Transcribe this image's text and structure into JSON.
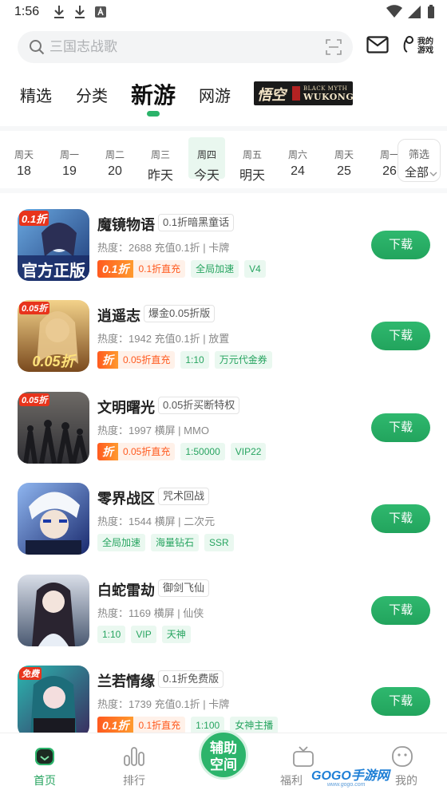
{
  "status_bar": {
    "time": "1:56"
  },
  "search": {
    "placeholder": "三国志战歌"
  },
  "header": {
    "my_games_line1": "我的",
    "my_games_line2": "游戏"
  },
  "tabs": [
    {
      "label": "精选"
    },
    {
      "label": "分类"
    },
    {
      "label": "新游",
      "active": true
    },
    {
      "label": "网游"
    }
  ],
  "banner": {
    "cn": "悟空",
    "en_line1": "BLACK MYTH",
    "en_line2": "WUKONG"
  },
  "days": [
    {
      "weekday": "周天",
      "date": "18"
    },
    {
      "weekday": "周一",
      "date": "19"
    },
    {
      "weekday": "周二",
      "date": "20"
    },
    {
      "weekday": "周三",
      "date": "昨天"
    },
    {
      "weekday": "周四",
      "date": "今天",
      "selected": true
    },
    {
      "weekday": "周五",
      "date": "明天"
    },
    {
      "weekday": "周六",
      "date": "24"
    },
    {
      "weekday": "周天",
      "date": "25"
    },
    {
      "weekday": "周一",
      "date": "26"
    }
  ],
  "filter": {
    "title": "筛选",
    "value": "全部"
  },
  "games": [
    {
      "name": "魔镜物语",
      "tagline": "0.1折暗黑童话",
      "heat_label": "热度：",
      "heat": "2688",
      "meta": "充值0.1折 | 卡牌",
      "discount_badge": "0.1折",
      "discount_text": "0.1折直充",
      "tags": [
        "全局加速",
        "V4"
      ],
      "thumb_text": "官方正版",
      "thumb_badge": "0.1折",
      "thumb_colors": [
        "#1e3b78",
        "#6aa8e0"
      ],
      "download": "下载"
    },
    {
      "name": "逍遥志",
      "tagline": "爆金0.05折版",
      "heat_label": "热度：",
      "heat": "1942",
      "meta": "充值0.1折 | 放置",
      "discount_badge": "折",
      "discount_text": "0.05折直充",
      "tags": [
        "1:10",
        "万元代金券"
      ],
      "thumb_text": "0.05折",
      "thumb_badge": "0.05折",
      "thumb_colors": [
        "#7a4a1e",
        "#f3d28a"
      ],
      "download": "下载"
    },
    {
      "name": "文明曙光",
      "tagline": "0.05折买断特权",
      "heat_label": "热度：",
      "heat": "1997",
      "meta": "横屏 | MMO",
      "discount_badge": "折",
      "discount_text": "0.05折直充",
      "tags": [
        "1:50000",
        "VIP22"
      ],
      "thumb_text": "",
      "thumb_badge": "0.05折",
      "thumb_colors": [
        "#2e2e33",
        "#6e6a66"
      ],
      "download": "下载"
    },
    {
      "name": "零界战区",
      "tagline": "咒术回战",
      "heat_label": "热度：",
      "heat": "1544",
      "meta": "横屏 | 二次元",
      "discount_badge": "",
      "discount_text": "",
      "tags": [
        "全局加速",
        "海量钻石",
        "SSR"
      ],
      "thumb_text": "",
      "thumb_badge": "",
      "thumb_colors": [
        "#1a2a6e",
        "#8fb6f0"
      ],
      "download": "下载"
    },
    {
      "name": "白蛇雷劫",
      "tagline": "御剑飞仙",
      "heat_label": "热度：",
      "heat": "1169",
      "meta": "横屏 | 仙侠",
      "discount_badge": "",
      "discount_text": "",
      "tags": [
        "1:10",
        "VIP",
        "天神"
      ],
      "thumb_text": "",
      "thumb_badge": "",
      "thumb_colors": [
        "#4b5a72",
        "#d9dee8"
      ],
      "download": "下载"
    },
    {
      "name": "兰若情缘",
      "tagline": "0.1折免费版",
      "heat_label": "热度：",
      "heat": "1739",
      "meta": "充值0.1折 | 卡牌",
      "discount_badge": "0.1折",
      "discount_text": "0.1折直充",
      "tags": [
        "1:100",
        "女神主播"
      ],
      "thumb_text": "",
      "thumb_badge": "免费",
      "thumb_colors": [
        "#3a2b5e",
        "#2bb7b0"
      ],
      "download": "下载"
    }
  ],
  "bottom_nav": {
    "home": "首页",
    "rank": "排行",
    "assist_line1": "辅助",
    "assist_line2": "空间",
    "welfare": "福利",
    "mine": "我的"
  },
  "watermark": {
    "main": "GOGO手游网",
    "sub": "www.gogo.com"
  }
}
